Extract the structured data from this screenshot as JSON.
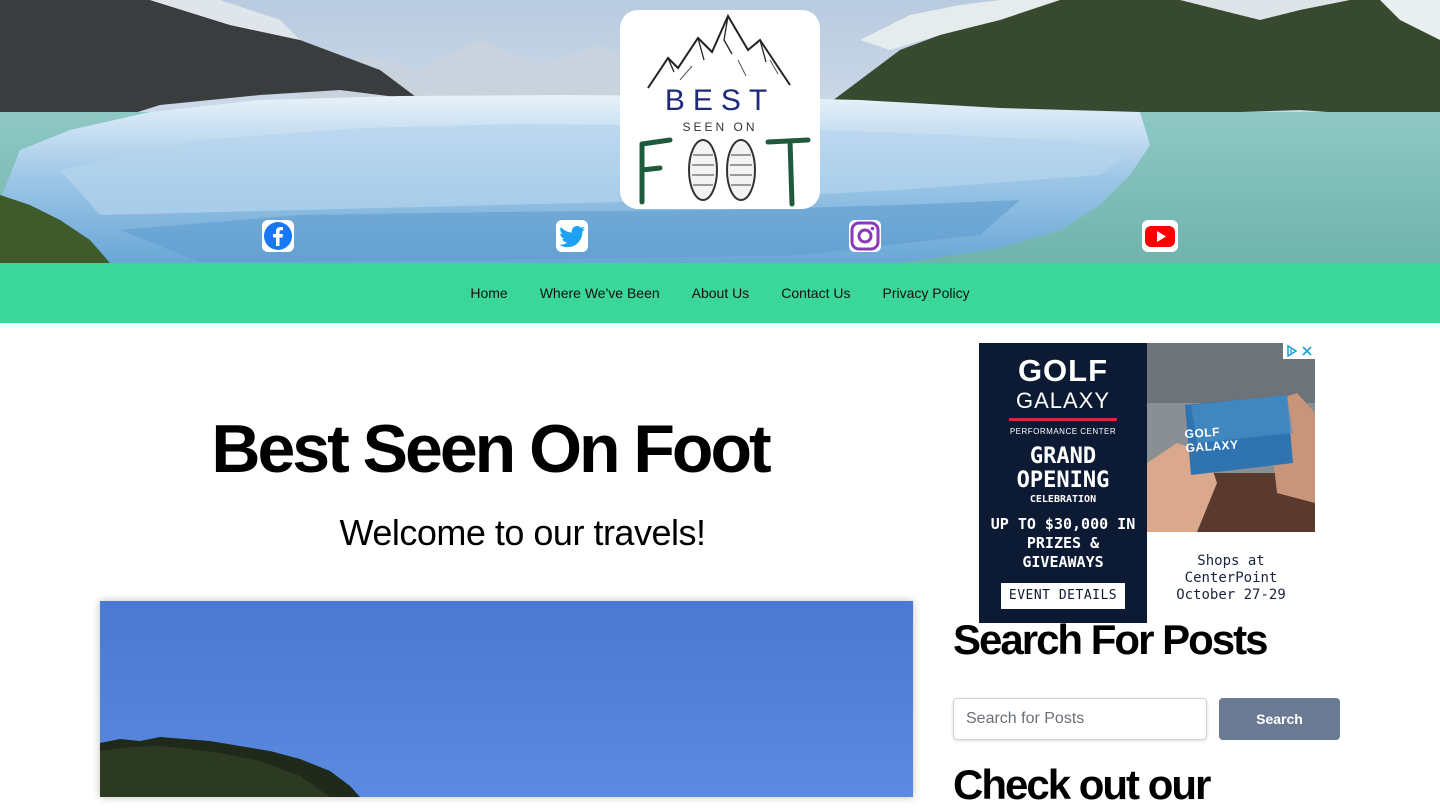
{
  "header": {
    "logo": {
      "word_best": "BEST",
      "word_seen_on": "SEEN ON",
      "word_foot": "FOOT"
    },
    "social": [
      {
        "name": "facebook",
        "icon": "facebook-icon",
        "color": "#1877f2"
      },
      {
        "name": "twitter",
        "icon": "twitter-icon",
        "color": "#1da1f2"
      },
      {
        "name": "instagram",
        "icon": "instagram-icon",
        "color": "#8a3ab9"
      },
      {
        "name": "youtube",
        "icon": "youtube-icon",
        "color": "#ff0000"
      }
    ]
  },
  "nav": {
    "items": [
      "Home",
      "Where We've Been",
      "About Us",
      "Contact Us",
      "Privacy Policy"
    ],
    "background": "#3bd69a"
  },
  "main": {
    "title": "Best Seen On Foot",
    "tagline": "Welcome to our travels!"
  },
  "sidebar": {
    "ad": {
      "brand_line1": "GOLF",
      "brand_line2": "GALAXY",
      "subtitle": "PERFORMANCE CENTER",
      "headline": "GRAND OPENING",
      "headline_sub": "CELEBRATION",
      "prizes": "UP TO $30,000 IN PRIZES & GIVEAWAYS",
      "cta": "EVENT DETAILS",
      "card_text": "GOLF GALAXY",
      "location_line1": "Shops at",
      "location_line2": "CenterPoint",
      "dates": "October 27-29"
    },
    "search": {
      "heading": "Search For Posts",
      "placeholder": "Search for Posts",
      "button": "Search"
    },
    "next_heading": "Check out our"
  }
}
